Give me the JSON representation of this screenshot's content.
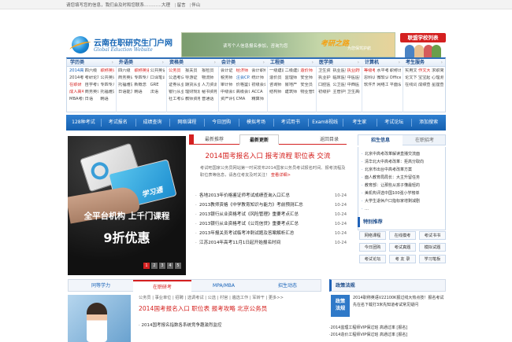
{
  "topbar": {
    "message": "请您填写您的信息，我们会及时和您联系…………大理",
    "links": [
      "留言",
      "伴山"
    ]
  },
  "header": {
    "logo_cn": "云南在职研究生门户网",
    "logo_en": "Global Eduction Website",
    "banner_slogan": "读写个人信息报名参加，咨询为您",
    "banner_tag": "考研之路",
    "banner_sub": "为您保驾护航",
    "hotline": "联盟学校列表"
  },
  "categories": [
    {
      "head": "学历类",
      "links": [
        {
          "t": "2014高考",
          "c": "blue"
        },
        {
          "t": "四六级",
          "c": ""
        },
        {
          "t": "职称英语",
          "c": "red"
        },
        {
          "t": "2014考研",
          "c": ""
        },
        {
          "t": "考研论坛",
          "c": ""
        },
        {
          "t": "公共英语",
          "c": ""
        },
        {
          "t": "在职研",
          "c": "red"
        },
        {
          "t": "自学考试",
          "c": ""
        },
        {
          "t": "专四专八",
          "c": ""
        },
        {
          "t": "成人高考",
          "c": "red"
        },
        {
          "t": "商务英语",
          "c": ""
        },
        {
          "t": "托福雅思",
          "c": ""
        },
        {
          "t": "MBA考试",
          "c": ""
        },
        {
          "t": "日语",
          "c": ""
        },
        {
          "t": "韩语",
          "c": ""
        }
      ]
    },
    {
      "head": "外语类",
      "links": [
        {
          "t": "四六级",
          "c": ""
        },
        {
          "t": "职称英语",
          "c": "red"
        },
        {
          "t": "公共英语",
          "c": ""
        },
        {
          "t": "商务英语",
          "c": ""
        },
        {
          "t": "专四专八",
          "c": ""
        },
        {
          "t": "口译笔译",
          "c": ""
        },
        {
          "t": "托福雅思",
          "c": ""
        },
        {
          "t": "新概念",
          "c": ""
        },
        {
          "t": "GRE",
          "c": ""
        },
        {
          "t": "日语能力",
          "c": ""
        },
        {
          "t": "韩语",
          "c": ""
        },
        {
          "t": "法语",
          "c": ""
        }
      ]
    },
    {
      "head": "资格类",
      "links": [
        {
          "t": "公务员",
          "c": "red"
        },
        {
          "t": "报关员",
          "c": ""
        },
        {
          "t": "报检员",
          "c": ""
        },
        {
          "t": "公选考试",
          "c": ""
        },
        {
          "t": "导游证",
          "c": ""
        },
        {
          "t": "物流师",
          "c": ""
        },
        {
          "t": "证券从业",
          "c": ""
        },
        {
          "t": "期货从业",
          "c": ""
        },
        {
          "t": "人力资源",
          "c": ""
        },
        {
          "t": "银行从业",
          "c": ""
        },
        {
          "t": "理财规划",
          "c": ""
        },
        {
          "t": "秘书资格",
          "c": ""
        },
        {
          "t": "社工考试",
          "c": ""
        },
        {
          "t": "教师资格",
          "c": ""
        },
        {
          "t": "普通话",
          "c": ""
        }
      ]
    },
    {
      "head": "会计类",
      "links": [
        {
          "t": "会计证",
          "c": ""
        },
        {
          "t": "经济师",
          "c": "red"
        },
        {
          "t": "会计职称",
          "c": ""
        },
        {
          "t": "税务师",
          "c": ""
        },
        {
          "t": "注会CPA",
          "c": "blue"
        },
        {
          "t": "统计师",
          "c": ""
        },
        {
          "t": "审计师",
          "c": ""
        },
        {
          "t": "价格鉴证",
          "c": ""
        },
        {
          "t": "初级会计",
          "c": ""
        },
        {
          "t": "中级会计",
          "c": ""
        },
        {
          "t": "高级会计",
          "c": ""
        },
        {
          "t": "ACCA",
          "c": ""
        },
        {
          "t": "资产评估",
          "c": ""
        },
        {
          "t": "CMA",
          "c": ""
        },
        {
          "t": "精算师",
          "c": ""
        }
      ]
    },
    {
      "head": "工程类",
      "links": [
        {
          "t": "一级建造",
          "c": ""
        },
        {
          "t": "二级建造",
          "c": ""
        },
        {
          "t": "造价师",
          "c": "red"
        },
        {
          "t": "造价员",
          "c": ""
        },
        {
          "t": "监理师",
          "c": ""
        },
        {
          "t": "安全师",
          "c": ""
        },
        {
          "t": "咨询师",
          "c": ""
        },
        {
          "t": "房地产",
          "c": ""
        },
        {
          "t": "安全员",
          "c": ""
        },
        {
          "t": "结构师",
          "c": ""
        },
        {
          "t": "建筑师",
          "c": ""
        },
        {
          "t": "物业管理",
          "c": ""
        }
      ]
    },
    {
      "head": "医学类",
      "links": [
        {
          "t": "卫生资格",
          "c": ""
        },
        {
          "t": "执业医师",
          "c": ""
        },
        {
          "t": "执业药师",
          "c": "red"
        },
        {
          "t": "执业护士",
          "c": ""
        },
        {
          "t": "临床医师",
          "c": ""
        },
        {
          "t": "中医医师",
          "c": ""
        },
        {
          "t": "口腔医师",
          "c": ""
        },
        {
          "t": "公卫医师",
          "c": ""
        },
        {
          "t": "中西医",
          "c": ""
        },
        {
          "t": "初级护师",
          "c": ""
        },
        {
          "t": "主管护师",
          "c": ""
        },
        {
          "t": "卫生高级",
          "c": ""
        }
      ]
    },
    {
      "head": "计算机",
      "links": [
        {
          "t": "等级考试",
          "c": "red"
        },
        {
          "t": "水平考试",
          "c": ""
        },
        {
          "t": "职称计算",
          "c": ""
        },
        {
          "t": "思科认证",
          "c": ""
        },
        {
          "t": "微软认证",
          "c": ""
        },
        {
          "t": "Office",
          "c": ""
        },
        {
          "t": "软件开发",
          "c": ""
        },
        {
          "t": "网络工程",
          "c": ""
        },
        {
          "t": "平面设计",
          "c": ""
        }
      ]
    },
    {
      "head": "考生服务",
      "links": [
        {
          "t": "实用文档",
          "c": ""
        },
        {
          "t": "作文大全",
          "c": "red"
        },
        {
          "t": "求职简历",
          "c": ""
        },
        {
          "t": "论文下载",
          "c": ""
        },
        {
          "t": "宝宝起名",
          "c": ""
        },
        {
          "t": "心理测试",
          "c": ""
        },
        {
          "t": "在线词典",
          "c": ""
        },
        {
          "t": "成绩查询",
          "c": ""
        },
        {
          "t": "星座查询",
          "c": ""
        }
      ]
    }
  ],
  "mainnav": [
    "128种考试",
    "考试报名",
    "成绩查询",
    "网络课程",
    "今日团购",
    "模拟考场",
    "考试用书",
    "Exam8视线",
    "考生家",
    "考试论坛",
    "添加搜索"
  ],
  "hero": {
    "card_text": "学习通",
    "line1": "全平台机构 上千门课程",
    "line2": "9折优惠",
    "dots": [
      "1",
      "2",
      "3",
      "4",
      "5"
    ]
  },
  "news": {
    "tabs": [
      "最新推荐",
      "最新更新",
      "返回目录"
    ],
    "headline": "2014国考报名入口 报考流程 职位表 交流",
    "summary": "考试吧国家公务员网站第一时间发布2014国家公务员考试报名时间、报考流程及职位表等信息，请各位考友及时关注！",
    "summary_more": "查看详细>",
    "items": [
      {
        "t": "各地2013年价格鉴证师考试成绩查询入口汇总",
        "d": "10-24"
      },
      {
        "t": "2013教师资格《中学教育知识与能力》考前预测汇总",
        "d": "10-24"
      },
      {
        "t": "2013银行从业资格考试《风险管理》重要考点汇总",
        "d": "10-24"
      },
      {
        "t": "2013银行从业资格考试《公司信贷》重要考点汇总",
        "d": "10-24"
      },
      {
        "t": "2013年报关员考试临考冲刺试题及答案解析汇总",
        "d": "10-24"
      },
      {
        "t": "江苏2014年高考11月1日起开始报名时间",
        "d": "10-24"
      }
    ]
  },
  "right": {
    "tabs": [
      "招生信息",
      "在职招考"
    ],
    "items": [
      "北京中高考改革解读直播交流面",
      "清华北大中高考改革：拒高分取向",
      "北京市出台中高考改革方案",
      "面人教育局局长：大主升留任务",
      "教育部：让那些从孩子懂最轻的",
      "美机构评选中国100强小学榜单",
      "大学生退休户口指标家增剩减剧",
      "…"
    ],
    "special_title": "特别推荐",
    "special_links": [
      "网络课程",
      "在线模考",
      "考试书书",
      "今日团购",
      "考试真题",
      "模拟试题",
      "考试论坛",
      "考 友 录",
      "学习笔板"
    ]
  },
  "bottom": {
    "tabs": [
      "同等学力",
      "在职研考",
      "MPA/MBA",
      "招生动态"
    ],
    "cats": "公务员 | 事业单位 | 招聘 | 选调考试 | 公选 | 村官 | 遴选工作 | 军转干 | 更多>>",
    "headline": "2014国考报名入口  职位表  报考攻略  北京公务员",
    "item": "2014国考报名指数各系统竞争趣激烈监控"
  },
  "policy": {
    "title": "政策法规",
    "box": [
      "政策",
      "法规"
    ],
    "text": "2014职称英语V22100K报过线大热点技！报名考试先在名下载打3米先知道考试常见疑问",
    "items": [
      "·2014监理工程师VIP保过班  高通过率 [报名]",
      "·2014造价工程师VIP保过班  高通过率 [报名]"
    ]
  },
  "colors": {
    "accent_blue": "#1560b0",
    "accent_red": "#d42020"
  }
}
